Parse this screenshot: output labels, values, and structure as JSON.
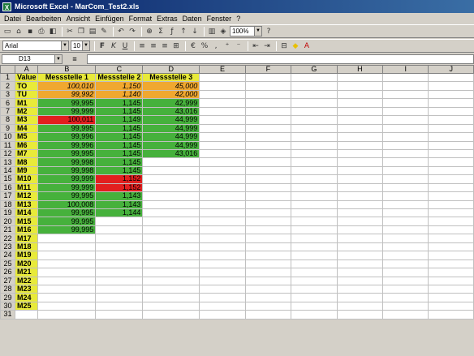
{
  "window": {
    "title": "Microsoft Excel - MarCom_Test2.xls",
    "app_icon": "excel-icon"
  },
  "menu": [
    "Datei",
    "Bearbeiten",
    "Ansicht",
    "Einfügen",
    "Format",
    "Extras",
    "Daten",
    "Fenster",
    "?"
  ],
  "toolbar": {
    "zoom": "100%",
    "font": "Arial",
    "size": "10",
    "help": "?"
  },
  "formula_bar": {
    "name_box": "D13",
    "eq": "=",
    "value": ""
  },
  "columns": [
    "A",
    "B",
    "C",
    "D",
    "E",
    "F",
    "G",
    "H",
    "I",
    "J"
  ],
  "header_row": {
    "a": "Value",
    "b": "Messstelle 1",
    "c": "Messstelle 2",
    "d": "Messstelle 3"
  },
  "rows": [
    {
      "n": "2",
      "a": "TO",
      "b": "100,010",
      "c": "1,150",
      "d": "45,000",
      "bc": "o",
      "cc": "o",
      "dc": "o"
    },
    {
      "n": "3",
      "a": "TU",
      "b": "99,992",
      "c": "1,140",
      "d": "42,000",
      "bc": "o",
      "cc": "o",
      "dc": "o"
    },
    {
      "n": "6",
      "a": "M1",
      "b": "99,995",
      "c": "1,145",
      "d": "42,999",
      "bc": "g",
      "cc": "g",
      "dc": "g"
    },
    {
      "n": "7",
      "a": "M2",
      "b": "99,999",
      "c": "1,145",
      "d": "43,016",
      "bc": "g",
      "cc": "g",
      "dc": "g"
    },
    {
      "n": "8",
      "a": "M3",
      "b": "100,011",
      "c": "1,149",
      "d": "44,999",
      "bc": "r",
      "cc": "g",
      "dc": "g"
    },
    {
      "n": "9",
      "a": "M4",
      "b": "99,995",
      "c": "1,145",
      "d": "44,999",
      "bc": "g",
      "cc": "g",
      "dc": "g"
    },
    {
      "n": "10",
      "a": "M5",
      "b": "99,996",
      "c": "1,145",
      "d": "44,999",
      "bc": "g",
      "cc": "g",
      "dc": "g"
    },
    {
      "n": "11",
      "a": "M6",
      "b": "99,996",
      "c": "1,145",
      "d": "44,999",
      "bc": "g",
      "cc": "g",
      "dc": "g"
    },
    {
      "n": "12",
      "a": "M7",
      "b": "99,995",
      "c": "1,145",
      "d": "43,016",
      "bc": "g",
      "cc": "g",
      "dc": "g"
    },
    {
      "n": "13",
      "a": "M8",
      "b": "99,998",
      "c": "1,145",
      "d": "",
      "bc": "g",
      "cc": "g",
      "dc": "sel"
    },
    {
      "n": "14",
      "a": "M9",
      "b": "99,998",
      "c": "1,145",
      "d": "",
      "bc": "g",
      "cc": "g",
      "dc": "w"
    },
    {
      "n": "15",
      "a": "M10",
      "b": "99,999",
      "c": "1,152",
      "d": "",
      "bc": "g",
      "cc": "r",
      "dc": "w"
    },
    {
      "n": "16",
      "a": "M11",
      "b": "99,999",
      "c": "1,152",
      "d": "",
      "bc": "g",
      "cc": "r",
      "dc": "w"
    },
    {
      "n": "17",
      "a": "M12",
      "b": "99,995",
      "c": "1,143",
      "d": "",
      "bc": "g",
      "cc": "g",
      "dc": "w"
    },
    {
      "n": "18",
      "a": "M13",
      "b": "100,008",
      "c": "1,143",
      "d": "",
      "bc": "g",
      "cc": "g",
      "dc": "w"
    },
    {
      "n": "19",
      "a": "M14",
      "b": "99,995",
      "c": "1,144",
      "d": "",
      "bc": "g",
      "cc": "g",
      "dc": "w"
    },
    {
      "n": "20",
      "a": "M15",
      "b": "99,995",
      "c": "",
      "d": "",
      "bc": "g",
      "cc": "w",
      "dc": "w"
    },
    {
      "n": "21",
      "a": "M16",
      "b": "99,995",
      "c": "",
      "d": "",
      "bc": "g",
      "cc": "w",
      "dc": "w"
    },
    {
      "n": "22",
      "a": "M17",
      "b": "",
      "c": "",
      "d": "",
      "bc": "w",
      "cc": "w",
      "dc": "w"
    },
    {
      "n": "23",
      "a": "M18",
      "b": "",
      "c": "",
      "d": "",
      "bc": "w",
      "cc": "w",
      "dc": "w"
    },
    {
      "n": "24",
      "a": "M19",
      "b": "",
      "c": "",
      "d": "",
      "bc": "w",
      "cc": "w",
      "dc": "w"
    },
    {
      "n": "25",
      "a": "M20",
      "b": "",
      "c": "",
      "d": "",
      "bc": "w",
      "cc": "w",
      "dc": "w"
    },
    {
      "n": "26",
      "a": "M21",
      "b": "",
      "c": "",
      "d": "",
      "bc": "w",
      "cc": "w",
      "dc": "w"
    },
    {
      "n": "27",
      "a": "M22",
      "b": "",
      "c": "",
      "d": "",
      "bc": "w",
      "cc": "w",
      "dc": "w"
    },
    {
      "n": "28",
      "a": "M23",
      "b": "",
      "c": "",
      "d": "",
      "bc": "w",
      "cc": "w",
      "dc": "w"
    },
    {
      "n": "29",
      "a": "M24",
      "b": "",
      "c": "",
      "d": "",
      "bc": "w",
      "cc": "w",
      "dc": "w"
    },
    {
      "n": "30",
      "a": "M25",
      "b": "",
      "c": "",
      "d": "",
      "bc": "w",
      "cc": "w",
      "dc": "w"
    },
    {
      "n": "31",
      "a": "",
      "b": "",
      "c": "",
      "d": "",
      "bc": "",
      "cc": "",
      "dc": ""
    }
  ]
}
